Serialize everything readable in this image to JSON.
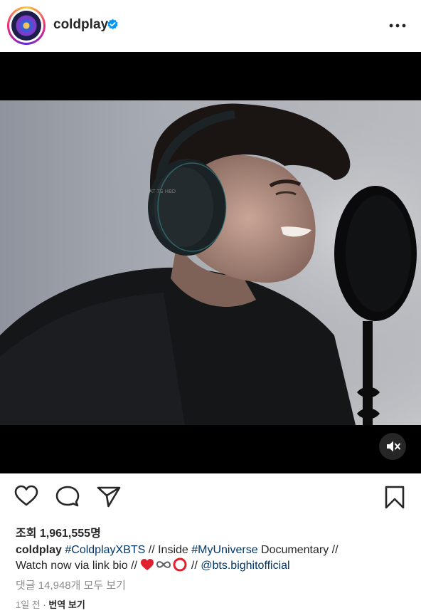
{
  "header": {
    "username": "coldplay",
    "more_icon": "more-horizontal-icon",
    "verified_icon": "verified-badge-icon"
  },
  "video": {
    "muted": true,
    "mute_icon": "speaker-muted-icon"
  },
  "actions": {
    "like_icon": "heart-icon",
    "comment_icon": "comment-bubble-icon",
    "share_icon": "paper-plane-icon",
    "save_icon": "bookmark-icon"
  },
  "views": "조회 1,961,555명",
  "caption": {
    "username": "coldplay",
    "hashtag1": "#ColdplayXBTS",
    "text1": " // Inside ",
    "hashtag2": "#MyUniverse",
    "text2": " Documentary //",
    "text3": "Watch now via link bio // ",
    "emoji": "❤️∞⭕",
    "text4": " // ",
    "mention": "@bts.bighitofficial"
  },
  "comments_link": "댓글 14,948개 모두 보기",
  "meta": {
    "time": "1일 전",
    "separator": " · ",
    "translate": "번역 보기"
  },
  "colors": {
    "link": "#00376b",
    "secondary": "#8e8e8e",
    "text": "#262626",
    "verified": "#0095f6"
  }
}
